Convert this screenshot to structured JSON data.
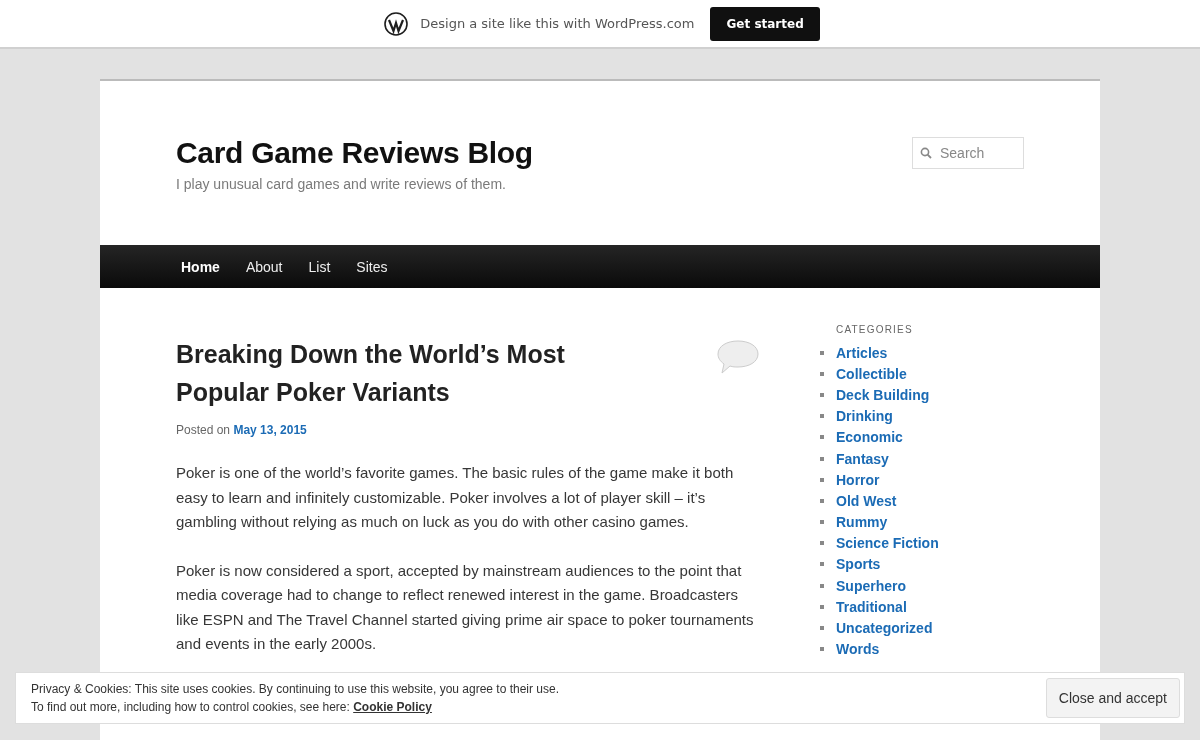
{
  "promo_bar": {
    "text": "Design a site like this with WordPress.com",
    "button": "Get started"
  },
  "site": {
    "title": "Card Game Reviews Blog",
    "tagline": "I play unusual card games and write reviews of them.",
    "search": {
      "placeholder": "Search"
    }
  },
  "nav": [
    {
      "label": "Home",
      "selected": true
    },
    {
      "label": "About",
      "selected": false
    },
    {
      "label": "List",
      "selected": false
    },
    {
      "label": "Sites",
      "selected": false
    }
  ],
  "post": {
    "title": "Breaking Down the World’s Most Popular Poker Variants",
    "posted_label": "Posted on",
    "date": "May 13, 2015",
    "paragraphs": [
      "Poker is one of the world’s favorite games. The basic rules of the game make it both easy to learn and infinitely customizable. Poker involves a lot of player skill – it’s gambling without relying as much on luck as you do with other casino games.",
      "Poker is now considered a sport, accepted by mainstream audiences to the point that media coverage had to change to reflect renewed interest in the game. Broadcasters like ESPN and The Travel Channel started giving prime air space to poker tournaments and events in the early 2000s."
    ]
  },
  "sidebar": {
    "heading": "CATEGORIES",
    "categories": [
      "Articles",
      "Collectible",
      "Deck Building",
      "Drinking",
      "Economic",
      "Fantasy",
      "Horror",
      "Old West",
      "Rummy",
      "Science Fiction",
      "Sports",
      "Superhero",
      "Traditional",
      "Uncategorized",
      "Words"
    ]
  },
  "cookie_banner": {
    "line1": "Privacy & Cookies: This site uses cookies. By continuing to use this website, you agree to their use.",
    "line2": "To find out more, including how to control cookies, see here:",
    "link": "Cookie Policy",
    "button": "Close and accept"
  }
}
